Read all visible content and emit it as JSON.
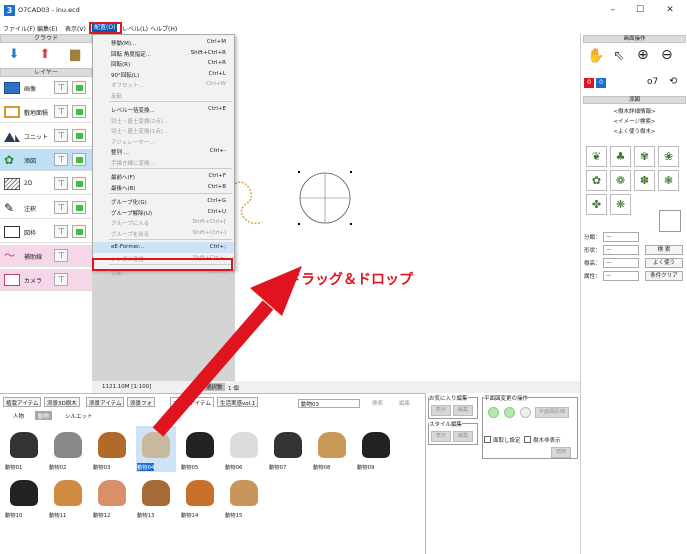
{
  "window": {
    "title": "O7CAD03 - inu.ecd",
    "app_icon": "3",
    "minimize": "–",
    "maximize": "☐",
    "close": "✕"
  },
  "menubar": {
    "items": [
      "ファイル(F)",
      "編集(E)",
      "表示(V)",
      "配置(O)",
      "レベル(L)",
      "ヘルプ(H)"
    ]
  },
  "left_panel": {
    "cloud_title": "クラウド",
    "layer_title": "レイヤー",
    "layers": [
      "画像",
      "敷地面積",
      "ユニット",
      "添図",
      "2D",
      "注釈",
      "図枠",
      "補助線",
      "カメラ"
    ]
  },
  "dropdown": {
    "items": [
      {
        "label": "移動(M)...",
        "shortcut": "Ctrl+M",
        "disabled": false
      },
      {
        "label": "回転 角度指定...",
        "shortcut": "Shift+Ctrl+R",
        "disabled": false
      },
      {
        "label": "回転(R)",
        "shortcut": "Ctrl+R",
        "disabled": false
      },
      {
        "label": "90°回転(L)",
        "shortcut": "Ctrl+L",
        "disabled": false
      },
      {
        "label": "オフセット...",
        "shortcut": "Ctrl+W",
        "disabled": true
      },
      {
        "label": "反転",
        "shortcut": "",
        "disabled": true
      },
      {
        "label": "レベル一括変換...",
        "shortcut": "Ctrl+E",
        "disabled": false
      },
      {
        "label": "切土・盛土変換(2点)...",
        "shortcut": "",
        "disabled": true
      },
      {
        "label": "切土・盛土変換(1点)...",
        "shortcut": "",
        "disabled": true
      },
      {
        "label": "アジェレーター...",
        "shortcut": "",
        "disabled": true
      },
      {
        "label": "整列 ...",
        "shortcut": "Ctrl+-",
        "disabled": false
      },
      {
        "label": "手描き線に変換...",
        "shortcut": "",
        "disabled": true
      },
      {
        "label": "最前へ(F)",
        "shortcut": "Ctrl+F",
        "disabled": false
      },
      {
        "label": "最後へ(B)",
        "shortcut": "Ctrl+B",
        "disabled": false
      },
      {
        "label": "グループ化(G)",
        "shortcut": "Ctrl+G",
        "disabled": false
      },
      {
        "label": "グループ解除(U)",
        "shortcut": "Ctrl+U",
        "disabled": false
      },
      {
        "label": "グループに入る",
        "shortcut": "Shift+Ctrl+[",
        "disabled": true
      },
      {
        "label": "グループを出る",
        "shortcut": "Shift+Ctrl+]",
        "disabled": true
      },
      {
        "label": "eE-Former...",
        "shortcut": "Ctrl+;",
        "disabled": false,
        "highlighted": true
      },
      {
        "label": "シンボル変換",
        "shortcut": "Shift+Ctrl+;",
        "disabled": true
      },
      {
        "label": "切断...",
        "shortcut": "Ctrl+/",
        "disabled": true
      }
    ]
  },
  "canvas": {
    "annotation": "ドラッグ＆ドロップ",
    "annotation_color": "#e0141e"
  },
  "statusbar": {
    "scale": "1121.10M [1:100]",
    "selected_label": "選択数",
    "selected_count": "1 個"
  },
  "bottom": {
    "tabs": [
      "植栽アイテム",
      "添景3D樹木",
      "添景アイテム",
      "添景フォ",
      "フォトアイテム",
      "生活実感vol.1"
    ],
    "active_tab": 4,
    "search_value": "動物03",
    "search_btn": "検索",
    "edit_btn": "編集",
    "subtabs": [
      "人物",
      "動物",
      "シルエット"
    ],
    "active_subtab": 1,
    "items": [
      "動物01",
      "動物02",
      "動物03",
      "動物04",
      "動物05",
      "動物06",
      "動物07",
      "動物08",
      "動物09",
      "動物10",
      "動物11",
      "動物12",
      "動物13",
      "動物14",
      "動物15"
    ],
    "selected_item": 3
  },
  "favorites": {
    "title": "お気に入り編集",
    "show": "表示",
    "edit": "編集",
    "style_title": "スタイル編集",
    "style_show": "表示",
    "style_edit": "編集"
  },
  "plan_ops": {
    "title": "平面図変更の操作",
    "reflect": "平面図反映",
    "check1": "面取し設定",
    "check2": "樹木非表示",
    "apply": "適用"
  },
  "right_panel": {
    "ops_title": "画面操作",
    "layer_a": "0",
    "layer_b": "0",
    "plants_title": "添図",
    "links": [
      "<樹木詳細情報>",
      "<イメージ検索>",
      "<よく使う樹木>"
    ],
    "filters": [
      {
        "label": "分類：",
        "value": "－"
      },
      {
        "label": "形状：",
        "value": "－"
      },
      {
        "label": "樹高：",
        "value": "－"
      },
      {
        "label": "属性：",
        "value": "－"
      }
    ],
    "buttons": [
      "検 索",
      "よく使う",
      "条件クリア"
    ]
  }
}
